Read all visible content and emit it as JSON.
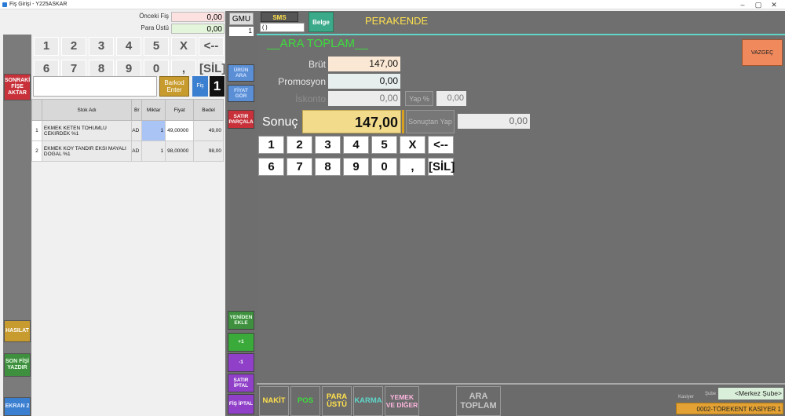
{
  "window": {
    "title": "Fiş Girişi - Y225ASKAR",
    "minimize": "–",
    "maximize": "▢",
    "close": "✕"
  },
  "top_fields": {
    "onceki_fis_label": "Önceki Fiş",
    "onceki_fis_value": "0,00",
    "para_ustu_label": "Para Üstü",
    "para_ustu_value": "0,00"
  },
  "left_rail": {
    "sonraki_fise_aktar": "SONRAKİ FİŞE AKTAR",
    "hasilat": "HASILAT",
    "son_fisi_yazdir": "SON FİŞİ YAZDIR",
    "ekran_2": "EKRAN 2"
  },
  "left_keypad": [
    "1",
    "2",
    "3",
    "4",
    "5",
    "X",
    "<--",
    "6",
    "7",
    "8",
    "9",
    "0",
    ",",
    "[SİL]"
  ],
  "barcode": {
    "enter_label": "Barkod Enter",
    "fis_label": "Fiş",
    "quantity": "1"
  },
  "table": {
    "headers": [
      "",
      "Stok Adı",
      "Br",
      "Miktar",
      "Fiyat",
      "Bedel"
    ],
    "rows": [
      {
        "no": "1",
        "name": "EKMEK KETEN TOHUMLU CEKIRDEK %1",
        "unit": "AD",
        "qty": "1",
        "price": "49,00000",
        "total": "49,00"
      },
      {
        "no": "2",
        "name": "EKMEK KOY TANDIR EKSI MAYALI DOGAL %1",
        "unit": "AD",
        "qty": "1",
        "price": "98,00000",
        "total": "98,00"
      }
    ]
  },
  "mid_rail": {
    "gmu": "GMU",
    "gmu_count": "1",
    "urun_ara": "ÜRÜN ARA",
    "fiyat_gor": "FİYAT GÖR",
    "satir_parcala": "SATIR PARÇALA",
    "yeniden_ekle": "YENİDEN EKLE",
    "plus_one": "+1",
    "minus_one": "-1",
    "satir_iptal": "SATIR İPTAL",
    "fis_iptal": "FİŞ İPTAL"
  },
  "header": {
    "sms": "SMS",
    "sms_field": "(  )",
    "belge": "Belge",
    "mode": "PERAKENDE"
  },
  "ara_toplam_panel": {
    "title": "__ARA TOPLAM__",
    "vazgec": "VAZGEÇ",
    "brut_label": "Brüt",
    "brut_value": "147,00",
    "promosyon_label": "Promosyon",
    "promosyon_value": "0,00",
    "iskonto_label": "İskonto",
    "iskonto_value": "0,00",
    "yap_pct_label": "Yap %",
    "yap_pct_value": "0,00",
    "sonuc_label": "Sonuç",
    "sonuc_value": "147,00",
    "sonuctan_yap": "Sonuçtan Yap",
    "sonuctan_value": "0,00",
    "keypad": [
      "1",
      "2",
      "3",
      "4",
      "5",
      "X",
      "<--",
      "6",
      "7",
      "8",
      "9",
      "0",
      ",",
      "[SİL]"
    ]
  },
  "payment_buttons": {
    "nakit": "NAKİT",
    "pos": "POS",
    "para_ustu": "PARA ÜSTÜ",
    "karma": "KARMA",
    "yemek_ve_diger": "YEMEK VE DİĞER",
    "ara_toplam": "ARA TOPLAM"
  },
  "footer": {
    "kasiyer_label": "Kasiyer",
    "sube_label": "Şube",
    "sube_value": "<Merkez Şube>",
    "kasiyer_value": "0002-TÖREKENT KASİYER 1"
  },
  "colors": {
    "accent_green": "#3ddc3d",
    "mode_yellow": "#ffe14d",
    "sonuc_fill": "#f2dc8c",
    "vazgec": "#f08a5d",
    "sonraki": "#c8313a"
  }
}
